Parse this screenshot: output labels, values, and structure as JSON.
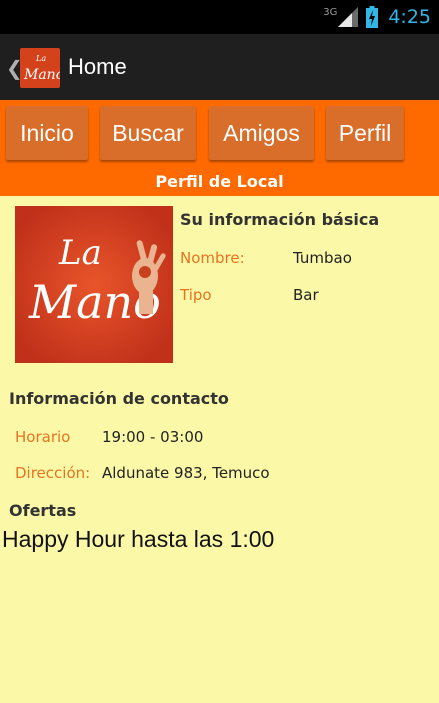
{
  "status_bar": {
    "network_type": "3G",
    "time": "4:25"
  },
  "action_bar": {
    "title": "Home",
    "logo_text_top": "La",
    "logo_text_bottom": "Mano"
  },
  "nav": [
    {
      "label": "Inicio"
    },
    {
      "label": "Buscar"
    },
    {
      "label": "Amigos"
    },
    {
      "label": "Perfil"
    }
  ],
  "section_header": "Perfil de Local",
  "venue": {
    "logo_text_top": "La",
    "logo_text_bottom": "Mano",
    "basic_info_title": "Su información básica",
    "fields": [
      {
        "label": "Nombre:",
        "value": "Tumbao"
      },
      {
        "label": "Tipo",
        "value": "Bar"
      }
    ]
  },
  "contact": {
    "title": "Información de contacto",
    "fields": [
      {
        "label": "Horario",
        "value": "19:00 - 03:00"
      },
      {
        "label": "Dirección:",
        "value": "Aldunate 983, Temuco"
      }
    ]
  },
  "offers": {
    "title": "Ofertas",
    "items": [
      "Happy Hour hasta las 1:00"
    ]
  },
  "colors": {
    "accent": "#ff6a00",
    "button": "#d86e2a",
    "content_bg": "#fbf9a7",
    "label": "#e8731f",
    "clock": "#33b5e5"
  }
}
